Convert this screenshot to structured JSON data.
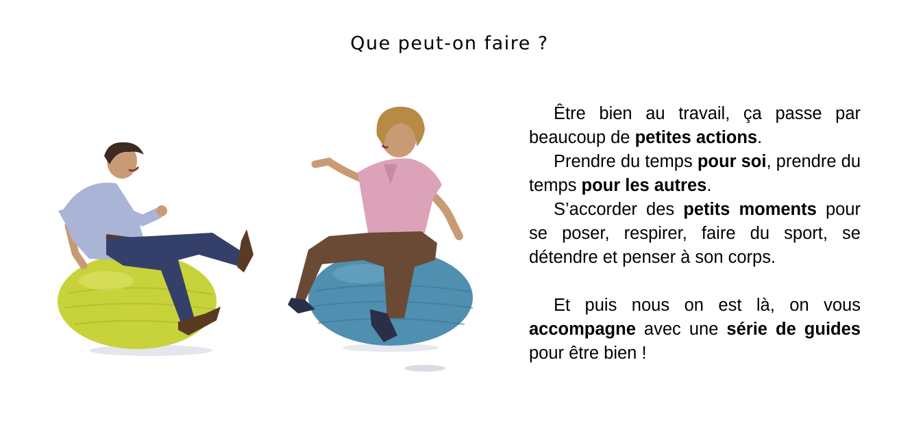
{
  "title": "Que peut-on faire ?",
  "paragraphs": [
    [
      {
        "t": "Être bien au travail, ça passe par beaucoup de "
      },
      {
        "t": "petites actions",
        "b": true
      },
      {
        "t": "."
      }
    ],
    [
      {
        "t": "Prendre du temps "
      },
      {
        "t": "pour soi",
        "b": true
      },
      {
        "t": ", prendre du temps "
      },
      {
        "t": "pour les autres",
        "b": true
      },
      {
        "t": "."
      }
    ],
    [
      {
        "t": "S’accorder des "
      },
      {
        "t": "petits moments",
        "b": true
      },
      {
        "t": " pour se poser, respirer, faire du sport, se détendre et penser à son corps."
      }
    ],
    [],
    [
      {
        "t": "Et puis nous on est là, on vous "
      },
      {
        "t": "accompagne",
        "b": true
      },
      {
        "t": " avec une "
      },
      {
        "t": "série de guides",
        "b": true
      },
      {
        "t": " pour être bien !"
      }
    ]
  ],
  "illustration": {
    "figures": [
      "man-on-yellow-ball",
      "woman-on-blue-ball"
    ],
    "colors": {
      "yellow_ball": "#c8d23a",
      "blue_ball": "#4f8fb0",
      "man_shirt": "#a9b4d6",
      "man_jeans": "#34406a",
      "woman_blouse": "#dca3b8",
      "woman_pants": "#6b4a35",
      "skin": "#c99b74",
      "hair_man": "#3d2a20",
      "hair_woman": "#b88a45",
      "shoes": "#5a3a22"
    }
  }
}
